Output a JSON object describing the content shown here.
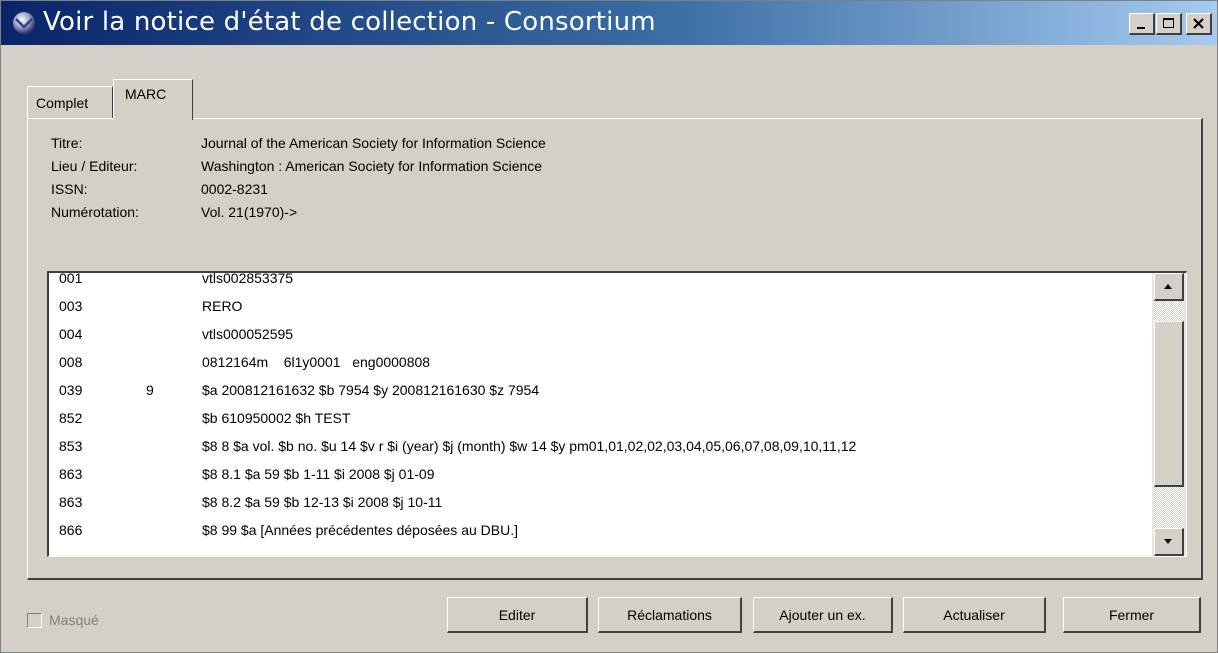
{
  "window": {
    "title": "Voir la notice d'état de collection - Consortium",
    "controls": {
      "minimize": "minimize-icon",
      "maximize": "maximize-icon",
      "close": "close-icon"
    }
  },
  "tabs": [
    {
      "label": "Complet",
      "active": false
    },
    {
      "label": "MARC",
      "active": true
    }
  ],
  "info": [
    {
      "label": "Titre:",
      "value": "Journal of the American Society for Information Science"
    },
    {
      "label": "Lieu / Editeur:",
      "value": "Washington : American Society for Information Science"
    },
    {
      "label": "ISSN:",
      "value": "0002-8231"
    },
    {
      "label": "Numérotation:",
      "value": "Vol. 21(1970)->"
    }
  ],
  "marc_rows": [
    {
      "tag": "001",
      "ind": "",
      "content": "vtls002853375"
    },
    {
      "tag": "003",
      "ind": "",
      "content": "RERO"
    },
    {
      "tag": "004",
      "ind": "",
      "content": "vtls000052595"
    },
    {
      "tag": "008",
      "ind": "",
      "content": "0812164m    6l1y0001   eng0000808"
    },
    {
      "tag": "039",
      "ind": "9",
      "content": "$a 200812161632 $b 7954 $y 200812161630 $z 7954"
    },
    {
      "tag": "852",
      "ind": "",
      "content": "$b 610950002 $h TEST"
    },
    {
      "tag": "853",
      "ind": "",
      "content": "$8 8 $a vol. $b no. $u 14 $v r $i (year) $j (month) $w 14 $y pm01,01,02,02,03,04,05,06,07,08,09,10,11,12"
    },
    {
      "tag": "863",
      "ind": "",
      "content": "$8 8.1 $a 59 $b 1-11 $i 2008 $j 01-09"
    },
    {
      "tag": "863",
      "ind": "",
      "content": "$8 8.2 $a 59 $b 12-13 $i 2008 $j 10-11"
    },
    {
      "tag": "866",
      "ind": "",
      "content": "$8 99 $a [Années précédentes déposées au DBU.]"
    }
  ],
  "hidden_checkbox": {
    "label": "Masqué",
    "checked": false,
    "enabled": false
  },
  "buttons": {
    "edit": "Editer",
    "claims": "Réclamations",
    "add_copy": "Ajouter un ex.",
    "refresh": "Actualiser",
    "close": "Fermer"
  },
  "colors": {
    "face": "#d4d0c8",
    "title_start": "#0a246a",
    "title_end": "#a6caf0",
    "disabled_text": "#808080"
  }
}
